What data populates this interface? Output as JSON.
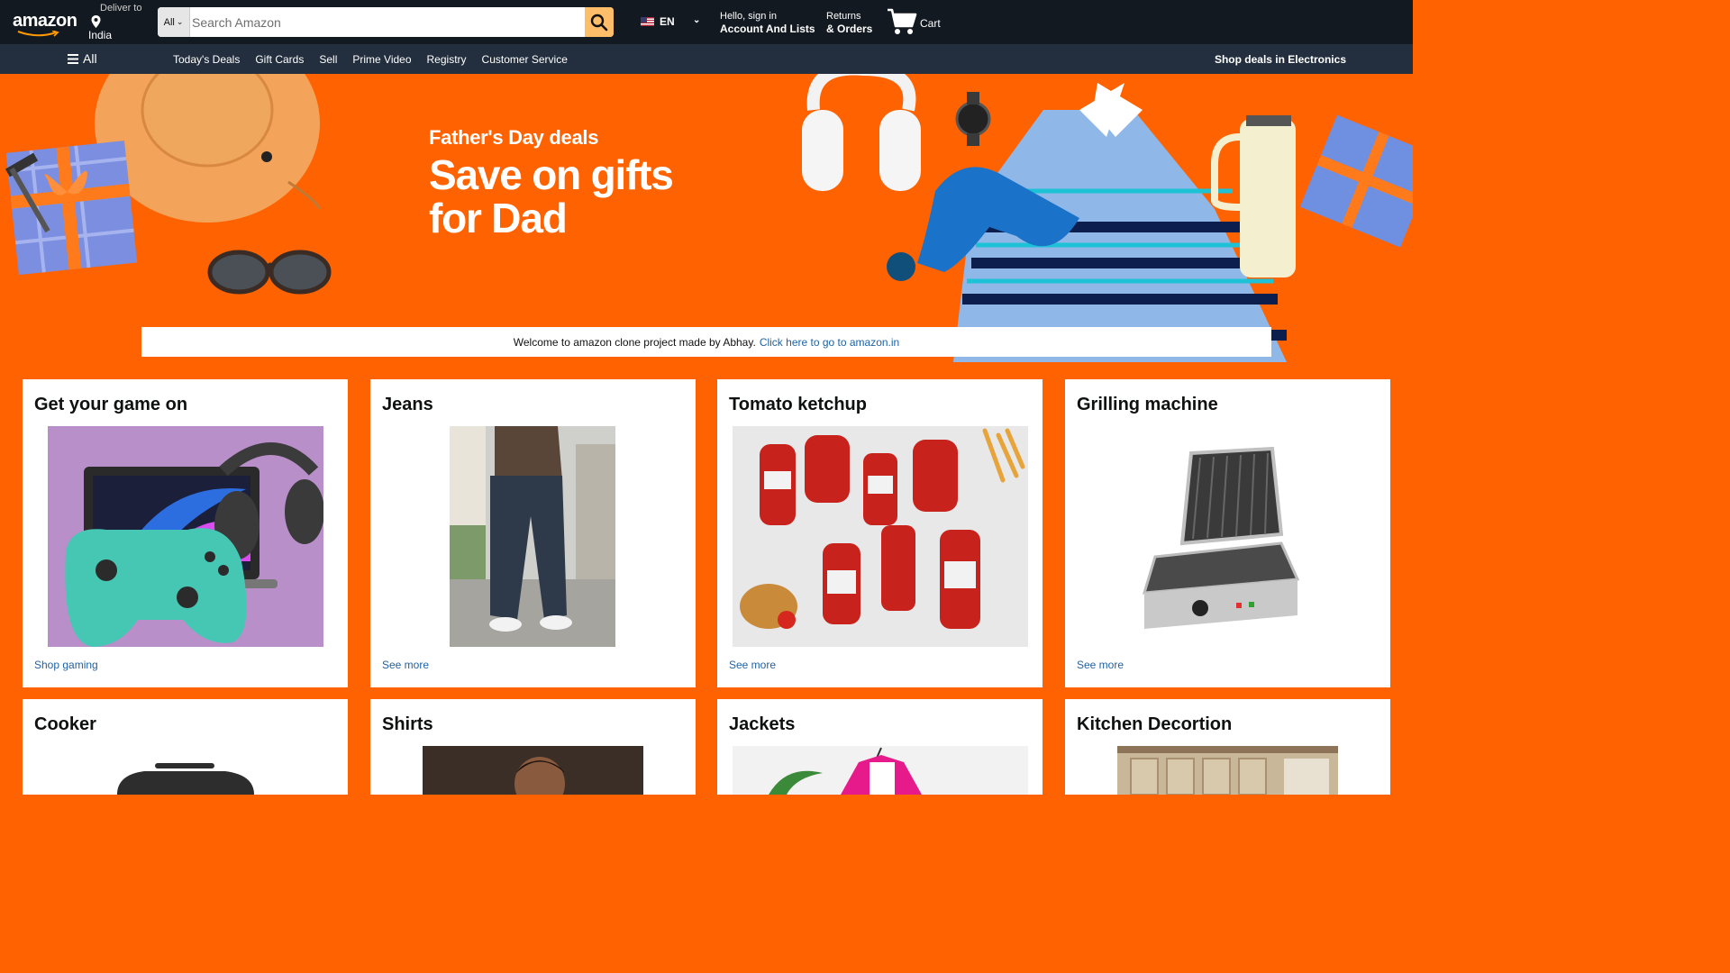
{
  "header": {
    "logo_text": "amazon",
    "deliver_label": "Deliver to",
    "deliver_country": "India",
    "search": {
      "category": "All",
      "placeholder": "Search Amazon"
    },
    "language": "EN",
    "account_greeting": "Hello, sign in",
    "account_label": "Account And Lists",
    "returns_label": "Returns",
    "orders_label": "& Orders",
    "cart_label": "Cart"
  },
  "subnav": {
    "all_label": "All",
    "links": [
      "Today's Deals",
      "Gift Cards",
      "Sell",
      "Prime Video",
      "Registry",
      "Customer Service"
    ],
    "promo": "Shop deals in Electronics"
  },
  "hero": {
    "subtitle": "Father's Day deals",
    "title_line1": "Save on gifts",
    "title_line2": "for Dad"
  },
  "welcome": {
    "text": "Welcome to amazon clone project made by Abhay.",
    "link": "Click here to go to amazon.in"
  },
  "cards": [
    {
      "title": "Get your game on",
      "link": "Shop gaming"
    },
    {
      "title": "Jeans",
      "link": "See more"
    },
    {
      "title": "Tomato ketchup",
      "link": "See more"
    },
    {
      "title": "Grilling machine",
      "link": "See more"
    },
    {
      "title": "Cooker"
    },
    {
      "title": "Shirts"
    },
    {
      "title": "Jackets"
    },
    {
      "title": "Kitchen Decortion"
    }
  ],
  "colors": {
    "nav_bg": "#131921",
    "subnav_bg": "#232f3e",
    "page_bg": "#ff6200",
    "search_button": "#febd69",
    "link": "#2162a1"
  }
}
